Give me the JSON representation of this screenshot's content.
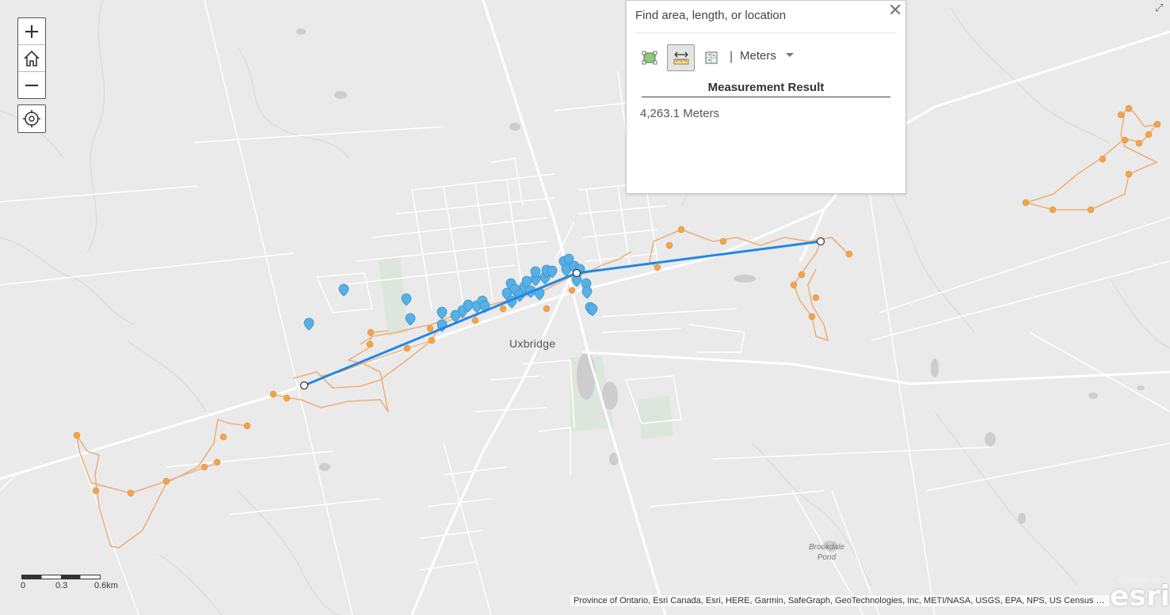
{
  "map": {
    "town_label": "Uxbridge",
    "pond_label_line1": "Brookdale",
    "pond_label_line2": "Pond",
    "colors": {
      "measure_line": "#1e88e5",
      "tracks": "#f0a860",
      "markers": "#5ab3e6",
      "roads": "#ffffff",
      "land": "#eaeaea"
    }
  },
  "zoom": {
    "in_label": "+",
    "out_label": "−"
  },
  "measurement": {
    "search_placeholder": "Find area, length, or location",
    "unit": "Meters",
    "result_title": "Measurement Result",
    "result_value": "4,263.1 Meters",
    "close_label": "✕"
  },
  "scalebar": {
    "labels": [
      "0",
      "0.3",
      "0.6km"
    ]
  },
  "attribution": "Province of Ontario, Esri Canada, Esri, HERE, Garmin, SafeGraph, GeoTechnologies, Inc, METI/NASA, USGS, EPA, NPS, US Census B...",
  "logo": {
    "powered_by": "POWERED BY",
    "brand": "esri"
  }
}
